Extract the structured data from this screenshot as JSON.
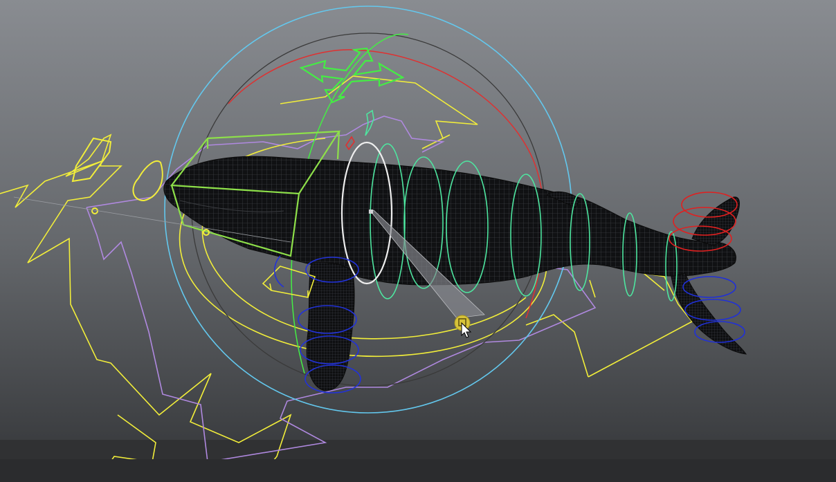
{
  "viewport": {
    "label": "",
    "background_top": "#8a8d92",
    "background_bottom": "#3a3c3f"
  },
  "model": {
    "name": "",
    "mesh_color": "#111214",
    "wire_color": "#5a5d62"
  },
  "rig_colors": {
    "cog_circle_outer": "#63c8ee",
    "cog_circle_inner": "#3a3a3a",
    "rotate_ring": "#e03030",
    "root_arrows": "#f2ee3a",
    "root_arrows_secondary": "#b089e0",
    "translate_cross": "#44ee44",
    "body_box": "#8ee04a",
    "spine_rings": "#4ee6a0",
    "fin_rings": "#2232d8",
    "tail_rings_red": "#e02020",
    "tail_rings_blue": "#2030d8",
    "ik_handle": "#d8d8d8",
    "selection_pivot": "#d7c33a"
  },
  "cursor": {
    "icon": "arrow-cursor"
  }
}
